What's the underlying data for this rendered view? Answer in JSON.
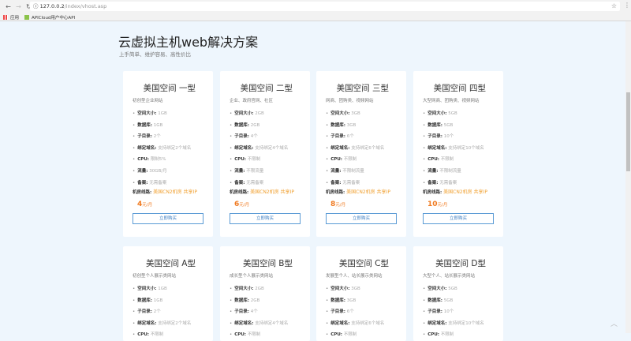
{
  "browser": {
    "url_host": "127.0.0.2",
    "url_path": "/index/vhost.asp",
    "bookmarks": [
      {
        "label": "应用"
      },
      {
        "label": "APICloud用户中心API"
      }
    ]
  },
  "page": {
    "title": "云虚拟主机web解决方案",
    "subtitle": "上手简单、维护容易、高性价比",
    "buy_label": "立即购买",
    "machine_label": "机房线路:",
    "machine_value": "美国CN2机房",
    "ip_value": "共享IP",
    "unit": "元/月"
  },
  "cards": [
    {
      "name": "美国空间 一型",
      "desc": "初创型企业网站",
      "price": "4",
      "items": [
        [
          "空间大小:",
          "1GB"
        ],
        [
          "数据库:",
          "1GB"
        ],
        [
          "子目录:",
          "2个"
        ],
        [
          "绑定域名:",
          "支持绑定2个域名"
        ],
        [
          "CPU:",
          "限制5%"
        ],
        [
          "流量:",
          "30GB/月"
        ],
        [
          "备案:",
          "无需备案"
        ]
      ]
    },
    {
      "name": "美国空间 二型",
      "desc": "企业、政府官网、社区",
      "price": "6",
      "items": [
        [
          "空间大小:",
          "2GB"
        ],
        [
          "数据库:",
          "2GB"
        ],
        [
          "子目录:",
          "4个"
        ],
        [
          "绑定域名:",
          "支持绑定4个域名"
        ],
        [
          "CPU:",
          "不限制"
        ],
        [
          "流量:",
          "不限流量"
        ],
        [
          "备案:",
          "无需备案"
        ]
      ]
    },
    {
      "name": "美国空间 三型",
      "desc": "网商、团购类、视频网站",
      "price": "8",
      "items": [
        [
          "空间大小:",
          "3GB"
        ],
        [
          "数据库:",
          "3GB"
        ],
        [
          "子目录:",
          "6个"
        ],
        [
          "绑定域名:",
          "支持绑定6个域名"
        ],
        [
          "CPU:",
          "不限制"
        ],
        [
          "流量:",
          "不限制流量"
        ],
        [
          "备案:",
          "无需备案"
        ]
      ]
    },
    {
      "name": "美国空间 四型",
      "desc": "大型网商、团购类、视频网站",
      "price": "10",
      "items": [
        [
          "空间大小:",
          "5GB"
        ],
        [
          "数据库:",
          "5GB"
        ],
        [
          "子目录:",
          "10个"
        ],
        [
          "绑定域名:",
          "支持绑定10个域名"
        ],
        [
          "CPU:",
          "不限制"
        ],
        [
          "流量:",
          "不限制流量"
        ],
        [
          "备案:",
          "无需备案"
        ]
      ]
    },
    {
      "name": "美国空间 A型",
      "desc": "初创型个人展示类网站",
      "items": [
        [
          "空间大小:",
          "1GB"
        ],
        [
          "数据库:",
          "1GB"
        ],
        [
          "子目录:",
          "2个"
        ],
        [
          "绑定域名:",
          "支持绑定2个域名"
        ],
        [
          "CPU:",
          "不限制"
        ]
      ]
    },
    {
      "name": "美国空间 B型",
      "desc": "成长型个人展示类网站",
      "items": [
        [
          "空间大小:",
          "2GB"
        ],
        [
          "数据库:",
          "2GB"
        ],
        [
          "子目录:",
          "4个"
        ],
        [
          "绑定域名:",
          "支持绑定4个域名"
        ],
        [
          "CPU:",
          "不限制"
        ]
      ]
    },
    {
      "name": "美国空间 C型",
      "desc": "发展型个人、站长展示类网站",
      "items": [
        [
          "空间大小:",
          "3GB"
        ],
        [
          "数据库:",
          "3GB"
        ],
        [
          "子目录:",
          "6个"
        ],
        [
          "绑定域名:",
          "支持绑定6个域名"
        ],
        [
          "CPU:",
          "不限制"
        ]
      ]
    },
    {
      "name": "美国空间 D型",
      "desc": "大型个人、站长展示类网站",
      "items": [
        [
          "空间大小:",
          "5GB"
        ],
        [
          "数据库:",
          "5GB"
        ],
        [
          "子目录:",
          "10个"
        ],
        [
          "绑定域名:",
          "支持绑定10个域名"
        ],
        [
          "CPU:",
          "不限制"
        ]
      ]
    }
  ]
}
